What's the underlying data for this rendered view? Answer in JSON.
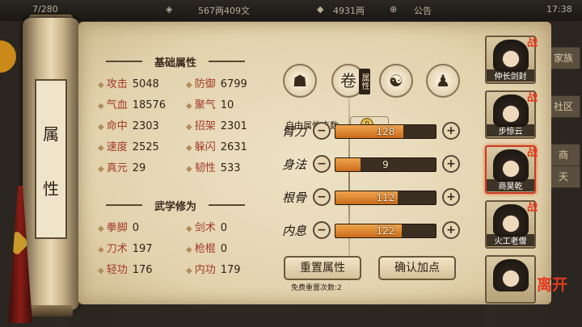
{
  "topbar": {
    "energy": "7/280",
    "currency_1": "567两409文",
    "silver": "4931两",
    "notice": "公告",
    "time": "17:38"
  },
  "side_tabs": [
    "家族",
    "社区",
    "商",
    "天"
  ],
  "scroll": {
    "title_1": "属",
    "title_2": "性"
  },
  "basic": {
    "title": "基础属性",
    "items": [
      {
        "label": "攻击",
        "value": "5048"
      },
      {
        "label": "防御",
        "value": "6799"
      },
      {
        "label": "气血",
        "value": "18576"
      },
      {
        "label": "聚气",
        "value": "10"
      },
      {
        "label": "命中",
        "value": "2303"
      },
      {
        "label": "招架",
        "value": "2301"
      },
      {
        "label": "速度",
        "value": "2525"
      },
      {
        "label": "躲闪",
        "value": "2631"
      },
      {
        "label": "真元",
        "value": "29"
      },
      {
        "label": "韧性",
        "value": "533"
      }
    ]
  },
  "martial": {
    "title": "武学修为",
    "items": [
      {
        "label": "拳脚",
        "value": "0"
      },
      {
        "label": "剑术",
        "value": "0"
      },
      {
        "label": "刀术",
        "value": "197"
      },
      {
        "label": "枪棍",
        "value": "0"
      },
      {
        "label": "轻功",
        "value": "176"
      },
      {
        "label": "内功",
        "value": "179"
      }
    ]
  },
  "tabs": [
    {
      "icon": "hat-icon",
      "glyph": "☗"
    },
    {
      "icon": "scroll-icon",
      "glyph": "卷",
      "badge": "属性"
    },
    {
      "icon": "taiji-icon",
      "glyph": "☯"
    },
    {
      "icon": "figure-icon",
      "glyph": "♟"
    }
  ],
  "free_points": {
    "label": "自由属性点数",
    "value": "0"
  },
  "stats": [
    {
      "name": "臂力",
      "value": "128",
      "fill": 0.68
    },
    {
      "name": "身法",
      "value": "9",
      "fill": 0.25
    },
    {
      "name": "根骨",
      "value": "112",
      "fill": 0.62
    },
    {
      "name": "内息",
      "value": "122",
      "fill": 0.66
    }
  ],
  "buttons": {
    "reset": "重置属性",
    "confirm": "确认加点"
  },
  "reset_info": "免费重置次数:2",
  "roster": [
    {
      "name": "仲长剑封",
      "star": "战"
    },
    {
      "name": "步惊云",
      "star": "战"
    },
    {
      "name": "商昊乾",
      "star": "战"
    },
    {
      "name": "火工老僧",
      "star": "战"
    },
    {
      "name": "",
      "star": ""
    }
  ],
  "close": "离开",
  "colors": {
    "accent_red": "#c83a24",
    "bar_fill": "#e08a2c",
    "paper": "#e9dcbc"
  }
}
